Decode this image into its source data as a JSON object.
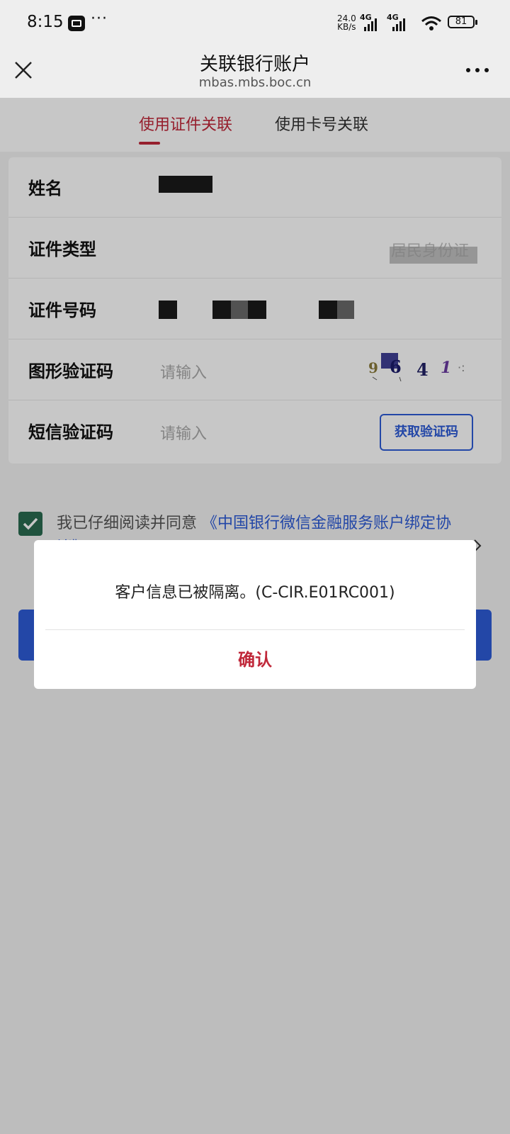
{
  "status_bar": {
    "time": "8:15",
    "more": "···",
    "net_speed_value": "24.0",
    "net_speed_unit": "KB/s",
    "sim1_label": "4G",
    "sim2_label": "4G",
    "battery": "81"
  },
  "header": {
    "title": "关联银行账户",
    "url": "mbas.mbs.boc.cn"
  },
  "tabs": [
    {
      "label": "使用证件关联",
      "active": true
    },
    {
      "label": "使用卡号关联",
      "active": false
    }
  ],
  "form": {
    "name_label": "姓名",
    "id_type_label": "证件类型",
    "id_type_value": "居民身份证",
    "id_number_label": "证件号码",
    "captcha_label": "图形验证码",
    "captcha_placeholder": "请输入",
    "captcha_text": "9641",
    "sms_label": "短信验证码",
    "sms_placeholder": "请输入",
    "get_code_button": "获取验证码"
  },
  "agreement": {
    "checked": true,
    "prefix": "我已仔细阅读并同意",
    "link1": "《中国银行微信金融服务账户绑定协议》"
  },
  "dialog": {
    "message": "客户信息已被隔离。(C-CIR.E01RC001)",
    "confirm": "确认"
  },
  "colors": {
    "accent_red": "#c0283a",
    "link_blue": "#2d5bd7",
    "check_green": "#2a6b50"
  }
}
